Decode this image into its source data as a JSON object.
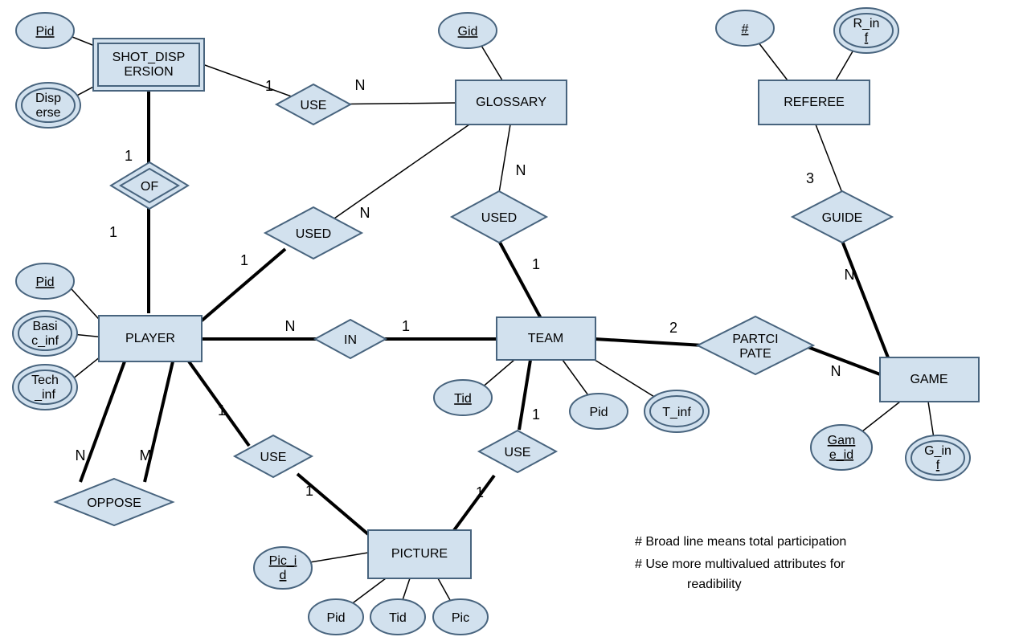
{
  "entities": {
    "shot_dispersion": "SHOT_DISP\nERSION",
    "glossary": "GLOSSARY",
    "referee": "REFEREE",
    "player": "PLAYER",
    "team": "TEAM",
    "game": "GAME",
    "picture": "PICTURE"
  },
  "relationships": {
    "use1": "USE",
    "of": "OF",
    "used1": "USED",
    "used2": "USED",
    "guide": "GUIDE",
    "in": "IN",
    "participate": "PARTCI\nPATE",
    "use2": "USE",
    "use3": "USE",
    "oppose": "OPPOSE"
  },
  "attributes": {
    "pid_sd": "Pid",
    "disperse": "Disp\nerse",
    "gid": "Gid",
    "hash": "#",
    "r_inf": "R_in\nf",
    "pid_player": "Pid",
    "basic_inf": "Basi\nc_inf",
    "tech_inf": "Tech\n_inf",
    "tid_team": "Tid",
    "pid_team": "Pid",
    "t_inf": "T_inf",
    "game_id": "Gam\ne_id",
    "g_inf": "G_in\nf",
    "pic_id": "Pic_i\nd",
    "pid_pic": "Pid",
    "tid_pic": "Tid",
    "pic": "Pic"
  },
  "cardinalities": {
    "sd_use": "1",
    "glossary_use": "N",
    "sd_of": "1",
    "player_of": "1",
    "glossary_used1_n": "N",
    "player_used1": "1",
    "glossary_used2_n": "N",
    "team_used2": "1",
    "player_in_n": "N",
    "team_in_1": "1",
    "team_participate": "2",
    "game_participate": "N",
    "referee_guide": "3",
    "game_guide": "N",
    "player_use2": "1",
    "picture_use2": "1",
    "team_use3": "1",
    "picture_use3": "1",
    "oppose_n": "N",
    "oppose_m": "M"
  },
  "notes": {
    "line1": "# Broad line means  total participation",
    "line2": "# Use more multivalued attributes for",
    "line3": "readibility"
  }
}
